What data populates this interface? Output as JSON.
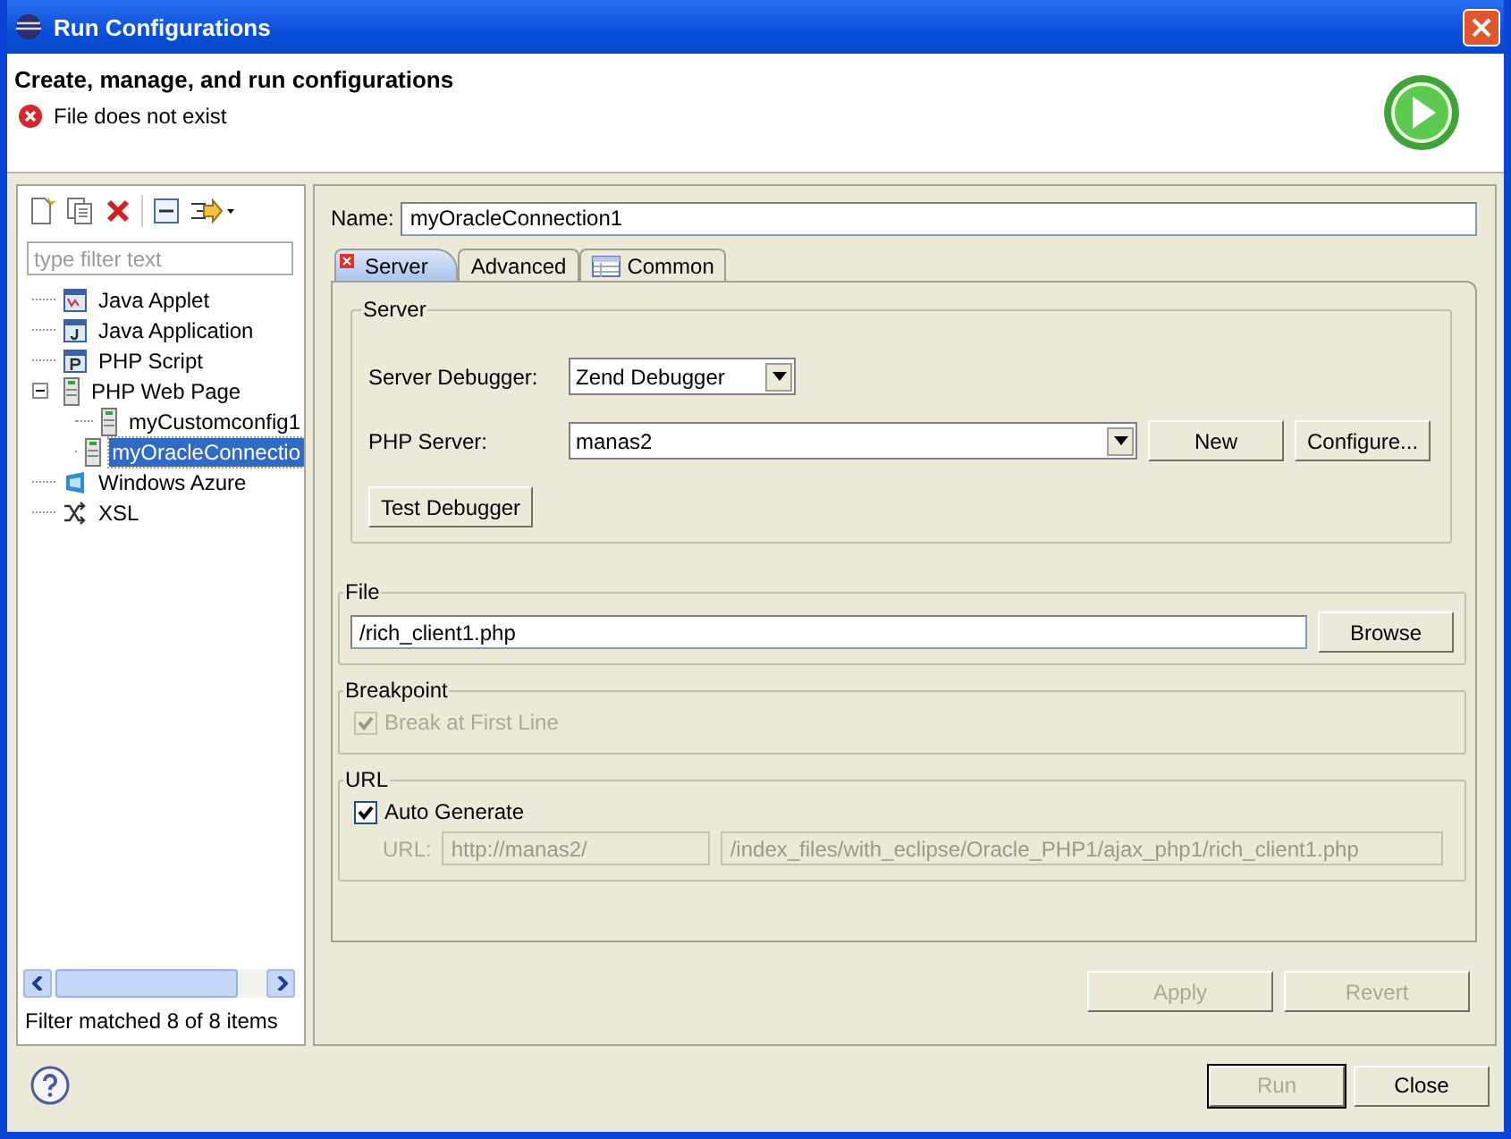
{
  "window": {
    "title": "Run Configurations"
  },
  "header": {
    "title": "Create, manage, and run configurations",
    "message": "File does not exist"
  },
  "sidebar": {
    "filter": {
      "placeholder": "type filter text"
    },
    "tree": [
      {
        "label": "Java Applet",
        "kind": "applet",
        "selected": false
      },
      {
        "label": "Java Application",
        "kind": "java",
        "selected": false
      },
      {
        "label": "PHP Script",
        "kind": "script",
        "selected": false
      },
      {
        "label": "PHP Web Page",
        "kind": "page",
        "selected": false,
        "expanded": true,
        "children": [
          {
            "label": "myCustomconfig1",
            "kind": "page",
            "selected": false
          },
          {
            "label": "myOracleConnectio",
            "kind": "page",
            "selected": true
          }
        ]
      },
      {
        "label": "Windows Azure",
        "kind": "azure",
        "selected": false
      },
      {
        "label": "XSL",
        "kind": "xsl",
        "selected": false
      }
    ],
    "status": "Filter matched 8 of 8 items"
  },
  "name_field": {
    "label": "Name:",
    "value": "myOracleConnection1"
  },
  "tabs": [
    {
      "label": "Server",
      "selected": true,
      "error": true
    },
    {
      "label": "Advanced",
      "selected": false,
      "error": false
    },
    {
      "label": "Common",
      "selected": false,
      "error": false
    }
  ],
  "server_group": {
    "title": "Server",
    "debugger_label": "Server Debugger:",
    "debugger_value": "Zend Debugger",
    "server_label": "PHP Server:",
    "server_value": "manas2",
    "buttons": [
      {
        "label": "New",
        "disabled": false
      },
      {
        "label": "Configure...",
        "disabled": false
      }
    ],
    "test_button": "Test Debugger"
  },
  "file_group": {
    "title": "File",
    "value": "/rich_client1.php",
    "button": "Browse"
  },
  "breakpoint_group": {
    "title": "Breakpoint",
    "checkbox": {
      "label": "Break at First Line",
      "checked": true,
      "disabled": true
    }
  },
  "url_group": {
    "title": "URL",
    "checkbox": {
      "label": "Auto Generate",
      "checked": true,
      "disabled": false
    },
    "url_label": "URL:",
    "base": "http://manas2/",
    "path": "/index_files/with_eclipse/Oracle_PHP1/ajax_php1/rich_client1.php",
    "disabled": true
  },
  "form_buttons": [
    {
      "label": "Apply",
      "disabled": true
    },
    {
      "label": "Revert",
      "disabled": true
    }
  ],
  "dialog_buttons": [
    {
      "label": "Run",
      "disabled": true,
      "default": true
    },
    {
      "label": "Close",
      "disabled": false,
      "default": false
    }
  ]
}
